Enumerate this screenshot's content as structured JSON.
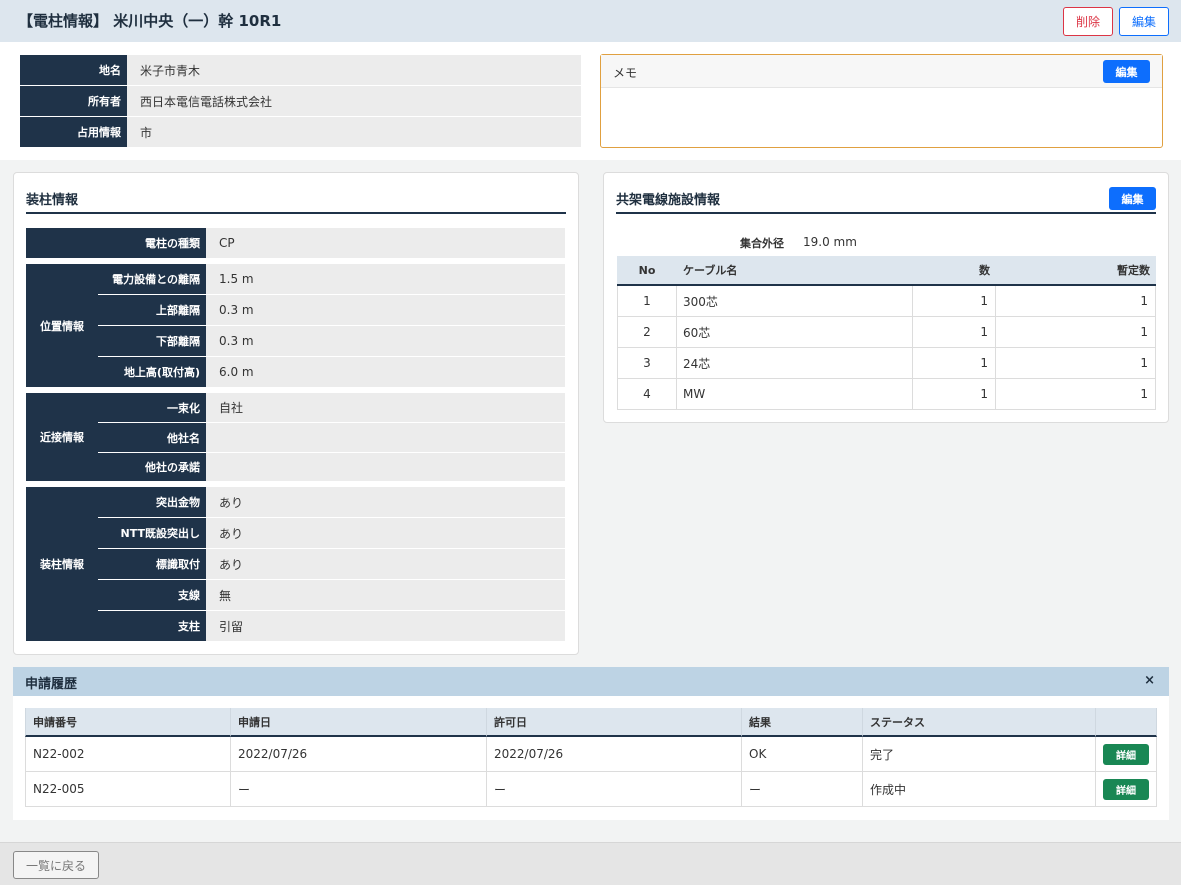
{
  "header": {
    "title": "【電柱情報】 米川中央（一）幹 10R1",
    "delete_label": "削除",
    "edit_label": "編集"
  },
  "basic": [
    {
      "label": "地名",
      "value": "米子市青木"
    },
    {
      "label": "所有者",
      "value": "西日本電信電話株式会社"
    },
    {
      "label": "占用情報",
      "value": "市"
    }
  ],
  "memo": {
    "label": "メモ",
    "edit_label": "編集",
    "content": ""
  },
  "pole": {
    "title": "装柱情報",
    "type_label": "電柱の種類",
    "type_value": "CP",
    "groups": [
      {
        "group": "位置情報",
        "rows": [
          {
            "label": "電力設備との離隔",
            "value": "1.5 m"
          },
          {
            "label": "上部離隔",
            "value": "0.3 m"
          },
          {
            "label": "下部離隔",
            "value": "0.3 m"
          },
          {
            "label": "地上高(取付高)",
            "value": "6.0 m"
          }
        ]
      },
      {
        "group": "近接情報",
        "rows": [
          {
            "label": "一束化",
            "value": "自社"
          },
          {
            "label": "他社名",
            "value": ""
          },
          {
            "label": "他社の承諾",
            "value": ""
          }
        ]
      },
      {
        "group": "装柱情報",
        "rows": [
          {
            "label": "突出金物",
            "value": "あり"
          },
          {
            "label": "NTT既設突出し",
            "value": "あり"
          },
          {
            "label": "標識取付",
            "value": "あり"
          },
          {
            "label": "支線",
            "value": "無"
          },
          {
            "label": "支柱",
            "value": "引留"
          }
        ]
      }
    ]
  },
  "cable": {
    "title": "共架電線施設情報",
    "edit_label": "編集",
    "diameter_label": "集合外径",
    "diameter_value": "19.0 mm",
    "columns": [
      "No",
      "ケーブル名",
      "数",
      "暫定数"
    ],
    "rows": [
      [
        "1",
        "300芯",
        "1",
        "1"
      ],
      [
        "2",
        "60芯",
        "1",
        "1"
      ],
      [
        "3",
        "24芯",
        "1",
        "1"
      ],
      [
        "4",
        "MW",
        "1",
        "1"
      ]
    ]
  },
  "history": {
    "title": "申請履歴",
    "close_label": "×",
    "columns": [
      "申請番号",
      "申請日",
      "許可日",
      "結果",
      "ステータス"
    ],
    "detail_label": "詳細",
    "rows": [
      [
        "N22-002",
        "2022/07/26",
        "2022/07/26",
        "OK",
        "完了"
      ],
      [
        "N22-005",
        "ー",
        "ー",
        "ー",
        "作成中"
      ]
    ]
  },
  "footer": {
    "back_label": "一覧に戻る"
  }
}
